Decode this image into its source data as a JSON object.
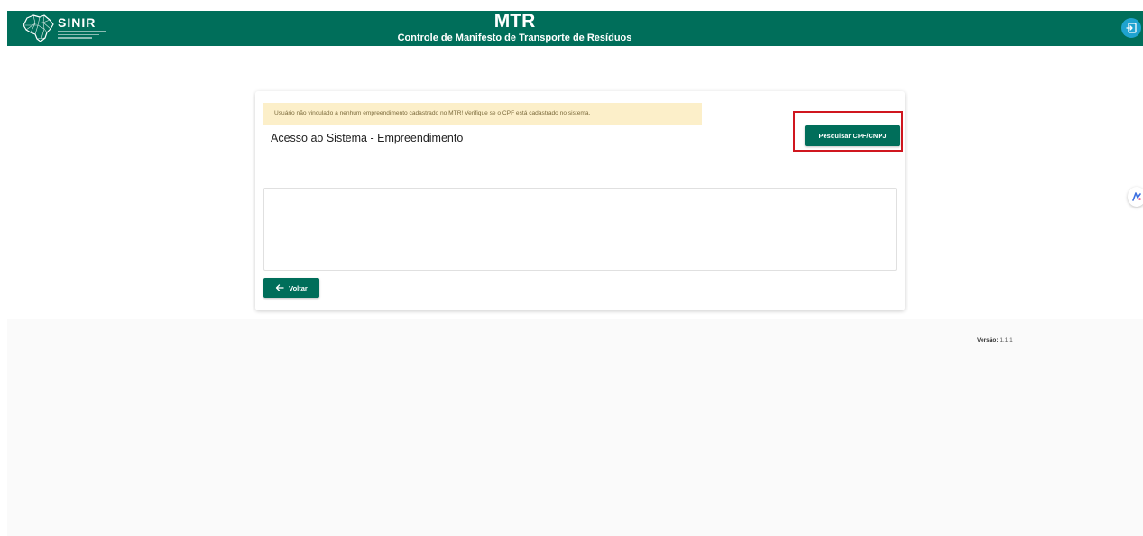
{
  "header": {
    "logo_text": "SINIR",
    "title": "MTR",
    "subtitle": "Controle de Manifesto de Transporte de Resíduos",
    "icons": {
      "logo": "brazil-map-logo-icon",
      "exit": "exit-icon"
    },
    "colors": {
      "brand": "#006e5a",
      "exit_button": "#1fa3d0"
    }
  },
  "card": {
    "alert": "Usuário não vinculado a nenhum empreendimento cadastrado no MTR! Verifique se o CPF está cadastrado no sistema.",
    "title": "Acesso ao Sistema - Empreendimento",
    "search_button": "Pesquisar CPF/CNPJ",
    "back_button": "Voltar",
    "icons": {
      "back": "arrow-left-icon"
    },
    "colors": {
      "alert_bg": "#fcefc9",
      "highlight": "#d0161f"
    }
  },
  "footer": {
    "version_label": "Versão:",
    "version_value": "1.1.1"
  },
  "side_widget": {
    "icon": "assistant-widget-icon"
  }
}
